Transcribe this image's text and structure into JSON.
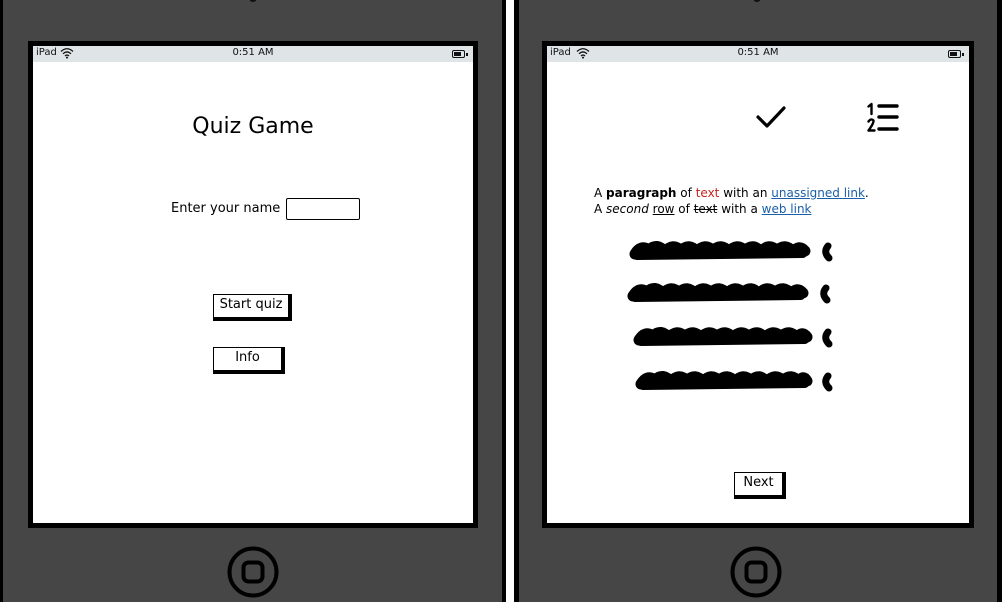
{
  "colors": {
    "bezel": "#464646",
    "status_bar": "#dfe4e6",
    "link": "#1a5fa8",
    "highlight": "#cc1f1f"
  },
  "left_device": {
    "status": {
      "carrier": "iPad",
      "time": "0:51 AM"
    },
    "title": "Quiz Game",
    "name_label": "Enter your name",
    "name_value": "",
    "start_label": "Start quiz",
    "info_label": "Info"
  },
  "right_device": {
    "status": {
      "carrier": "iPad",
      "time": "0:51 AM"
    },
    "icons": [
      "checkmark-icon",
      "numbered-list-icon"
    ],
    "paragraph": {
      "a1": "A ",
      "bold": "paragraph",
      "a2": " of ",
      "red": "text",
      "a3": " with an ",
      "link1": "unassigned link",
      "a4": ".",
      "b1": "A ",
      "italic": "second",
      "b2": " ",
      "under": "row",
      "b3": " of ",
      "strike": "text",
      "b4": " with a ",
      "link2": "web link"
    },
    "answer_rows": 4,
    "next_label": "Next"
  }
}
